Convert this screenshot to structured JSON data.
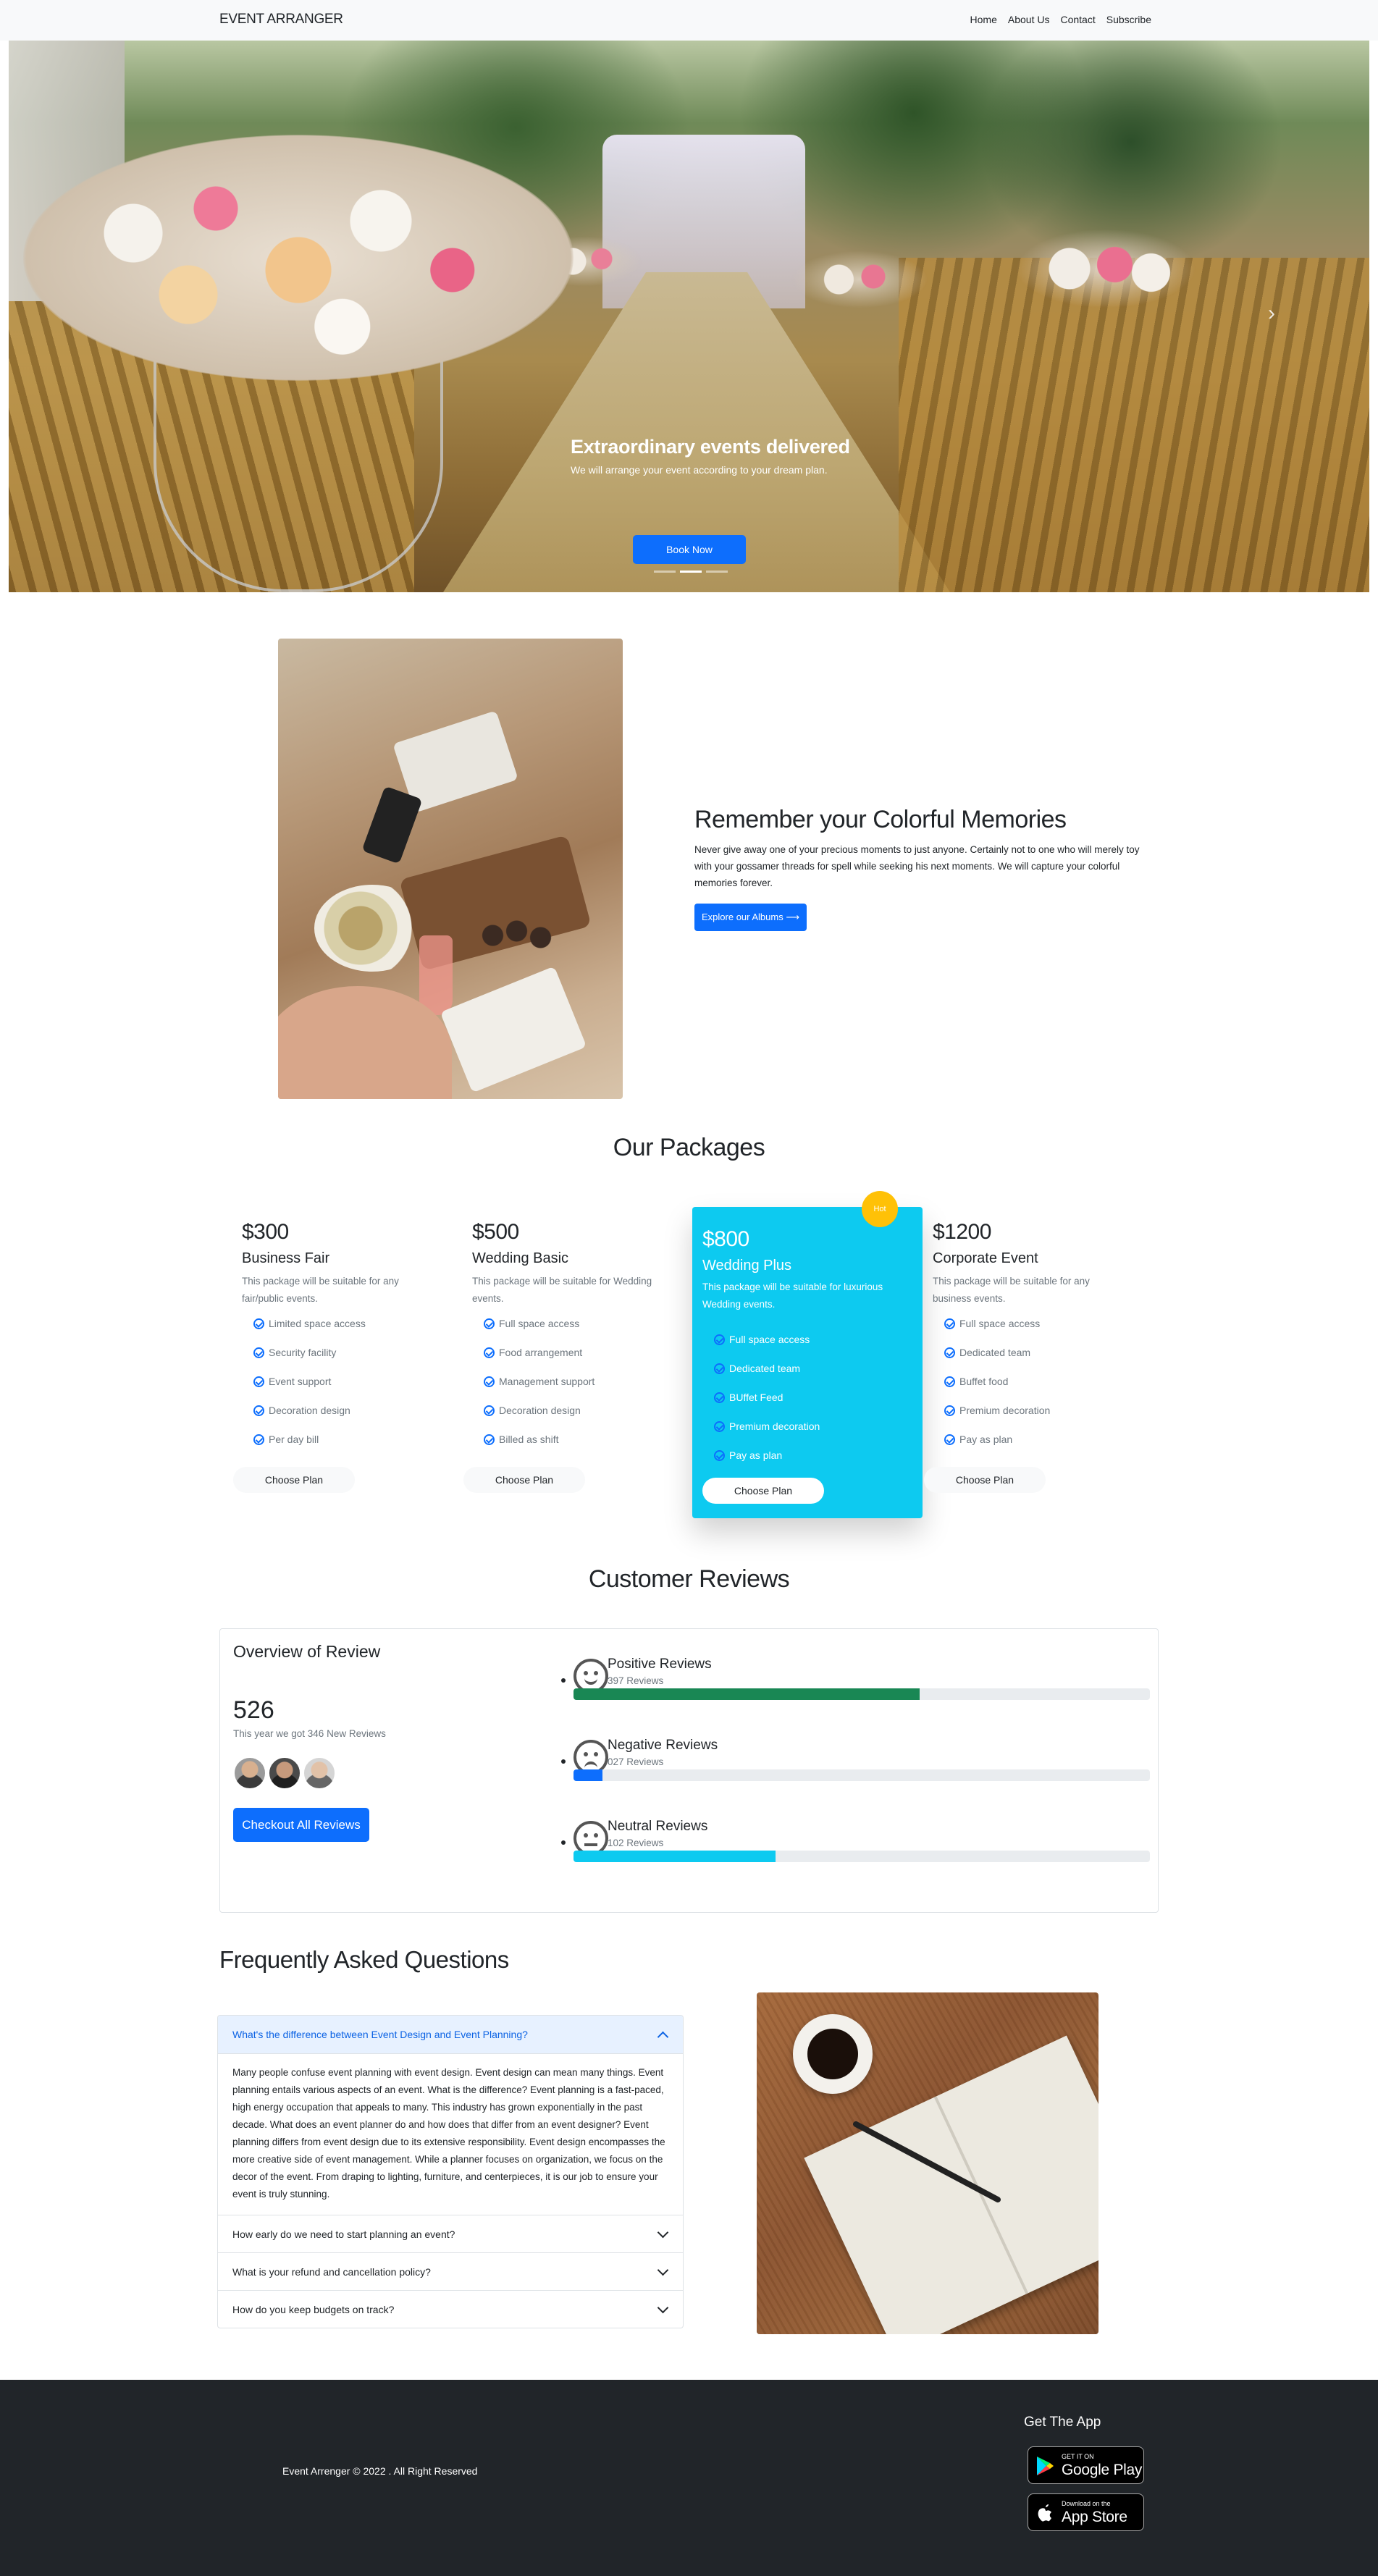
{
  "nav": {
    "brand": "EVENT ARRANGER",
    "links": [
      "Home",
      "About Us",
      "Contact",
      "Subscribe"
    ]
  },
  "hero": {
    "title": "Extraordinary events delivered",
    "subtitle": "We will arrange your event according to your dream plan.",
    "button": "Book Now",
    "next_icon": "›",
    "active_slide": 2
  },
  "memories": {
    "title": "Remember your Colorful Memories",
    "text": "Never give away one of your precious moments to just anyone. Certainly not to one who will merely toy with your gossamer threads for spell while seeking his next moments. We will capture your colorful memories forever.",
    "button": "Explore our Albums ⟶"
  },
  "packages": {
    "title": "Our Packages",
    "hot_badge": "Hot",
    "items": [
      {
        "price": "$300",
        "name": "Business Fair",
        "desc": "This package will be suitable for any fair/public events.",
        "features": [
          "Limited space access",
          "Security facility",
          "Event support",
          "Decoration design",
          "Per day bill"
        ],
        "button": "Choose Plan"
      },
      {
        "price": "$500",
        "name": "Wedding Basic",
        "desc": "This package will be suitable for Wedding events.",
        "features": [
          "Full space access",
          "Food arrangement",
          "Management support",
          "Decoration design",
          "Billed as shift"
        ],
        "button": "Choose Plan"
      },
      {
        "price": "$800",
        "name": "Wedding Plus",
        "desc": "This package will be suitable for luxurious Wedding events.",
        "features": [
          "Full space access",
          "Dedicated team",
          "BUffet Feed",
          "Premium decoration",
          "Pay as plan"
        ],
        "button": "Choose Plan"
      },
      {
        "price": "$1200",
        "name": "Corporate Event",
        "desc": "This package will be suitable for any business events.",
        "features": [
          "Full space access",
          "Dedicated team",
          "Buffet food",
          "Premium decoration",
          "Pay as plan"
        ],
        "button": "Choose Plan"
      }
    ]
  },
  "reviews": {
    "title": "Customer Reviews",
    "overview": "Overview of Review",
    "total": "526",
    "sub": "This year we got 346 New Reviews",
    "button": "Checkout All Reviews",
    "items": [
      {
        "label": "Positive Reviews",
        "count": "397 Reviews",
        "progress": 0.6,
        "color": "#198754",
        "face": "smile-icon"
      },
      {
        "label": "Negative Reviews",
        "count": "027 Reviews",
        "progress": 0.05,
        "color": "#0d6efd",
        "face": "frown-icon"
      },
      {
        "label": "Neutral Reviews",
        "count": "102 Reviews",
        "progress": 0.35,
        "color": "#0dcaf0",
        "face": "neutral-face-icon"
      }
    ]
  },
  "faq": {
    "title": "Frequently Asked Questions",
    "items": [
      {
        "q": "What's the difference between Event Design and Event Planning?",
        "a": "Many people confuse event planning with event design. Event design can mean many things. Event planning entails various aspects of an event. What is the difference? Event planning is a fast-paced, high energy occupation that appeals to many. This industry has grown exponentially in the past decade. What does an event planner do and how does that differ from an event designer? Event planning differs from event design due to its extensive responsibility. Event design encompasses the more creative side of event management. While a planner focuses on organization, we focus on the decor of the event. From draping to lighting, furniture, and centerpieces, it is our job to ensure your event is truly stunning."
      },
      {
        "q": "How early do we need to start planning an event?"
      },
      {
        "q": "What is your refund and cancellation policy?"
      },
      {
        "q": "How do you keep budgets on track?"
      }
    ]
  },
  "footer": {
    "copyright": "Event Arrenger © 2022 . All Right Reserved",
    "app_title": "Get The App",
    "google_small": "GET IT ON",
    "google_big": "Google Play",
    "apple_small": "Download on the",
    "apple_big": "App Store"
  }
}
